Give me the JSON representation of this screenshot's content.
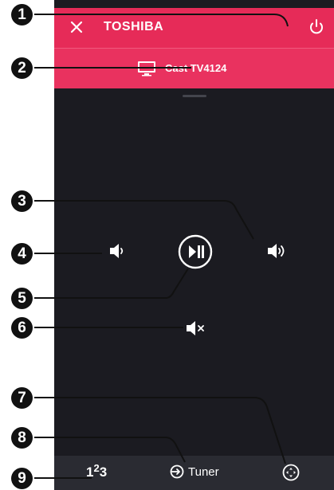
{
  "header": {
    "brand": "TOSHIBA"
  },
  "cast": {
    "label": "Cast TV4124"
  },
  "bottom_bar": {
    "tuner_label": "Tuner",
    "num_main": "1",
    "num_sup": "2",
    "num_end": "3"
  },
  "callouts": [
    "1",
    "2",
    "3",
    "4",
    "5",
    "6",
    "7",
    "8",
    "9"
  ],
  "colors": {
    "header": "#e62b58",
    "background": "#1b1b21",
    "bottom_bar": "#2a2b32"
  }
}
